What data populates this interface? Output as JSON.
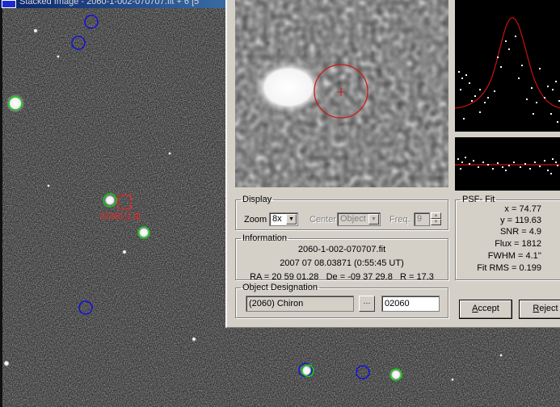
{
  "window": {
    "title": "Stacked Image - 2060-1-002-070707.fit + 6 [5"
  },
  "field": {
    "target_label": "02060 [1.9]",
    "markers": [
      {
        "type": "known",
        "color": "#0000ff"
      },
      {
        "type": "detected",
        "color": "#00d000"
      },
      {
        "type": "target",
        "color": "#ff2020"
      }
    ]
  },
  "display": {
    "legend": "Display",
    "zoom_label": "Zoom",
    "zoom_value": "8x",
    "center_label": "Center",
    "center_value": "Object",
    "freq_label": "Freq.",
    "freq_value": "9"
  },
  "information": {
    "legend": "Information",
    "filename": "2060-1-002-070707.fit",
    "date": "2007 07 08.03871 (0:55:45 UT)",
    "ra_label": "RA =",
    "ra": "20 59 01.28",
    "de_label": "De =",
    "de": "-09 37 29.8",
    "r_label": "R =",
    "r": "17.3"
  },
  "object_designation": {
    "legend": "Object Designation",
    "name": "(2060) Chiron",
    "number": "02060",
    "browse_icon": "ellipsis-icon"
  },
  "psf_fit": {
    "legend": "PSF- Fit",
    "lines": [
      "x = 74.77",
      "y = 119.63",
      "SNR = 4.9",
      "Flux = 1812",
      "FWHM = 4.1''",
      "Fit RMS = 0.199"
    ]
  },
  "buttons": {
    "accept_underline": "A",
    "accept_rest": "ccept",
    "reject_underline": "R",
    "reject_rest": "eject"
  },
  "colors": {
    "dialog_bg": "#d4d0c8",
    "fit_curve": "#cc1111",
    "aperture": "#d01818",
    "title_bar": "#0a246a"
  }
}
